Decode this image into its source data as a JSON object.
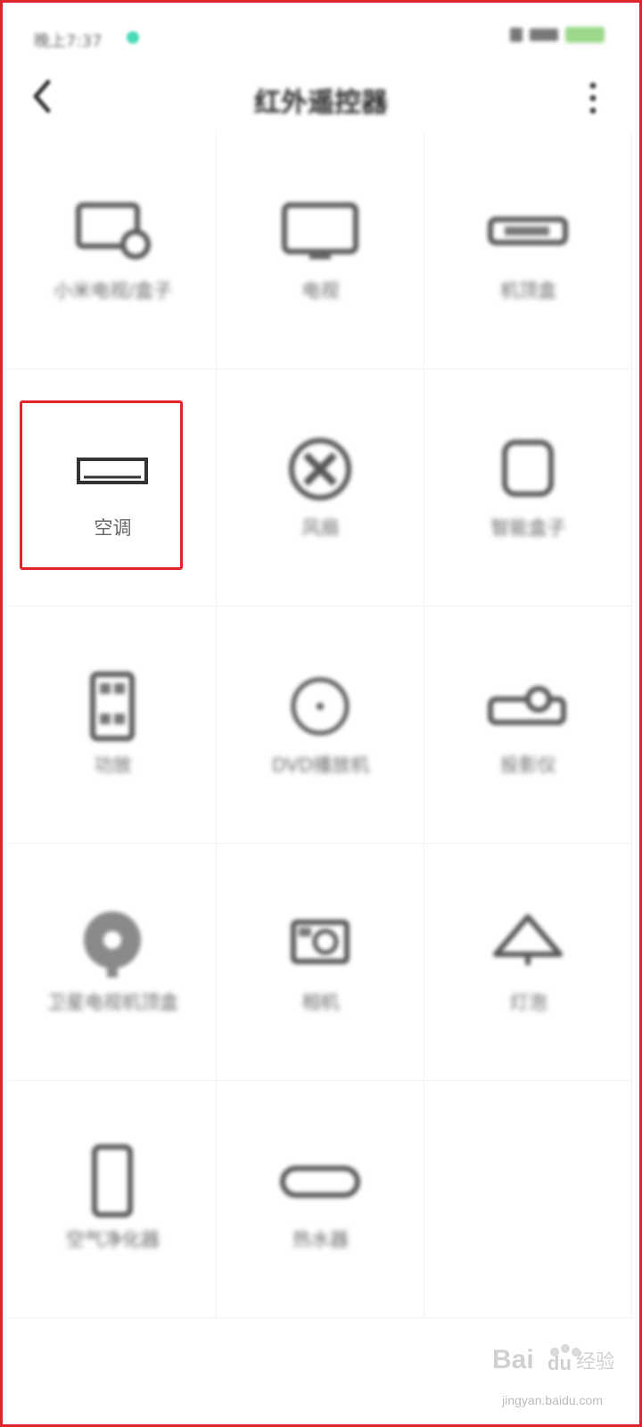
{
  "status_bar": {
    "time": "晚上7:37"
  },
  "header": {
    "title": "红外遥控器"
  },
  "devices": [
    {
      "label": "小米电视/盒子",
      "icon": "tv-box-icon"
    },
    {
      "label": "电视",
      "icon": "tv-icon"
    },
    {
      "label": "机顶盒",
      "icon": "set-top-box-icon"
    },
    {
      "label": "空调",
      "icon": "air-conditioner-icon",
      "selected": true
    },
    {
      "label": "风扇",
      "icon": "fan-icon"
    },
    {
      "label": "智能盒子",
      "icon": "smart-box-icon"
    },
    {
      "label": "功放",
      "icon": "amplifier-icon"
    },
    {
      "label": "DVD播放机",
      "icon": "dvd-player-icon"
    },
    {
      "label": "投影仪",
      "icon": "projector-icon"
    },
    {
      "label": "卫星电视机顶盒",
      "icon": "satellite-icon"
    },
    {
      "label": "相机",
      "icon": "camera-icon"
    },
    {
      "label": "灯泡",
      "icon": "lamp-icon"
    },
    {
      "label": "空气净化器",
      "icon": "air-purifier-icon"
    },
    {
      "label": "热水器",
      "icon": "water-heater-icon"
    }
  ],
  "watermark": {
    "text": "jingyan.baidu.com"
  },
  "colors": {
    "highlight": "#e0262a",
    "accent_dot": "#49d9b7"
  }
}
